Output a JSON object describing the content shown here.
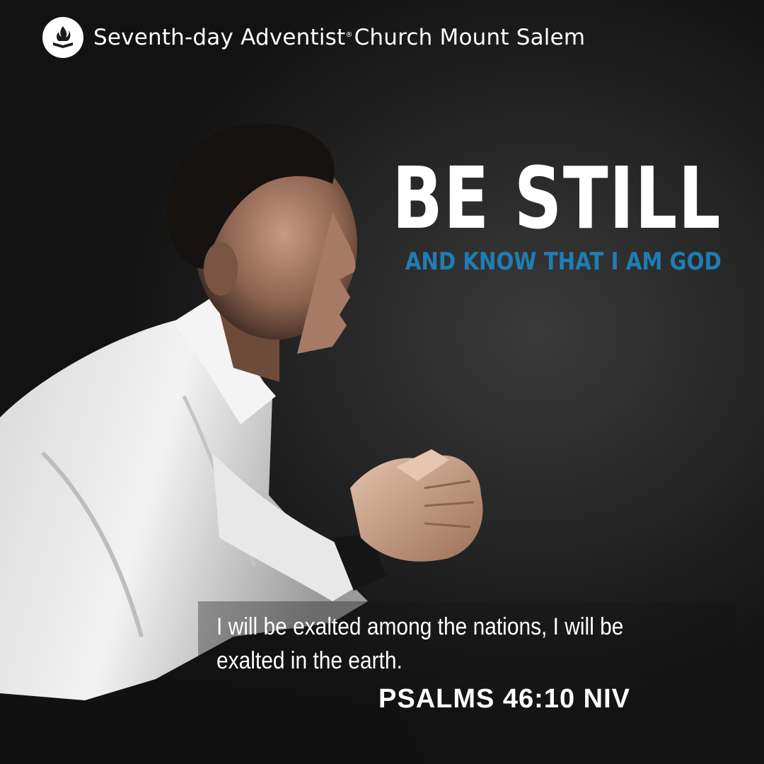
{
  "header": {
    "church_name_part1": "Seventh-day Adventist",
    "registered_mark": "®",
    "church_name_part2": "Church Mount Salem",
    "logo_icon": "adventist-flame-bible-logo"
  },
  "headline": {
    "title": "BE STILL",
    "subtitle": "AND KNOW THAT I AM GOD"
  },
  "verse": {
    "text": "I will be exalted among the nations, I will be exalted in the earth.",
    "reference": "PSALMS 46:10 NIV"
  },
  "colors": {
    "background": "#1e1e1e",
    "accent_blue": "#1f7db3",
    "text_white": "#ffffff"
  }
}
